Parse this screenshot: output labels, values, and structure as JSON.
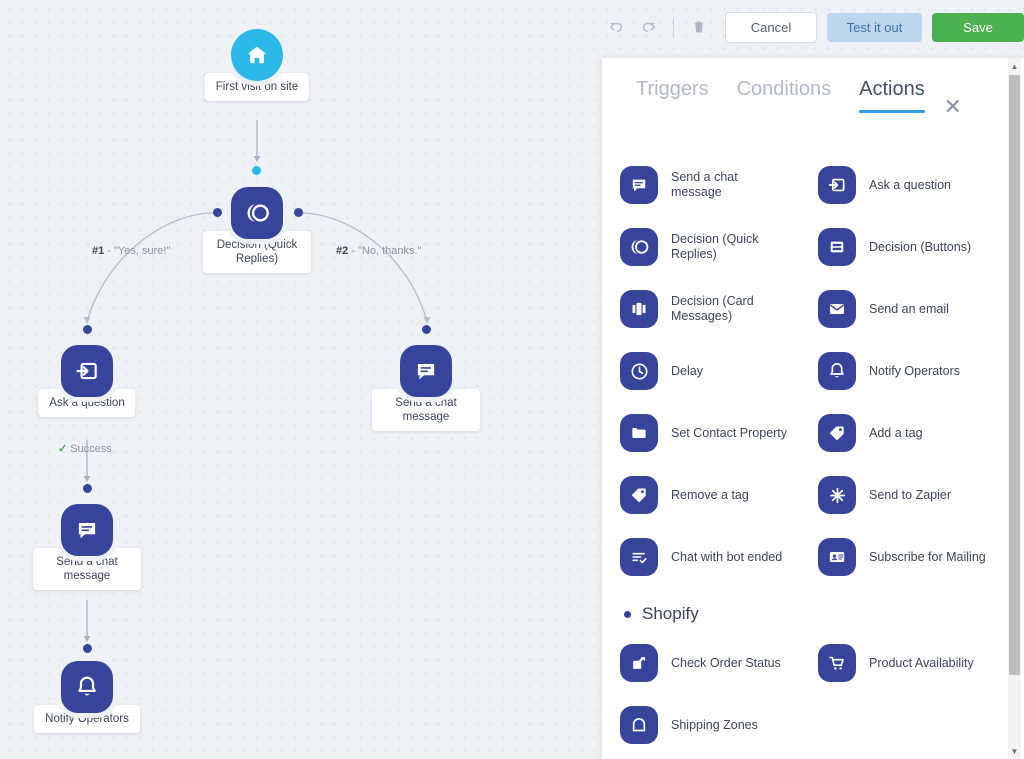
{
  "toolbar": {
    "undo_icon": "undo-icon",
    "redo_icon": "redo-icon",
    "delete_icon": "trash-icon",
    "cancel_label": "Cancel",
    "test_label": "Test it out",
    "save_label": "Save"
  },
  "panel": {
    "tabs": [
      {
        "label": "Triggers",
        "active": false
      },
      {
        "label": "Conditions",
        "active": false
      },
      {
        "label": "Actions",
        "active": true
      }
    ],
    "close_icon": "close-icon",
    "actions": [
      {
        "label": "Send a chat message",
        "icon": "chat-message-icon"
      },
      {
        "label": "Ask a question",
        "icon": "ask-question-icon"
      },
      {
        "label": "Decision (Quick Replies)",
        "icon": "quick-replies-icon"
      },
      {
        "label": "Decision (Buttons)",
        "icon": "decision-buttons-icon"
      },
      {
        "label": "Decision (Card Messages)",
        "icon": "card-messages-icon"
      },
      {
        "label": "Send an email",
        "icon": "email-icon"
      },
      {
        "label": "Delay",
        "icon": "clock-icon"
      },
      {
        "label": "Notify Operators",
        "icon": "bell-icon"
      },
      {
        "label": "Set Contact Property",
        "icon": "folder-icon"
      },
      {
        "label": "Add a tag",
        "icon": "tag-icon"
      },
      {
        "label": "Remove a tag",
        "icon": "tag-icon"
      },
      {
        "label": "Send to Zapier",
        "icon": "zapier-icon"
      },
      {
        "label": "Chat with bot ended",
        "icon": "chat-ended-icon"
      },
      {
        "label": "Subscribe for Mailing",
        "icon": "contact-card-icon"
      }
    ],
    "shopify": {
      "title": "Shopify",
      "items": [
        {
          "label": "Check Order Status",
          "icon": "order-status-icon"
        },
        {
          "label": "Product Availability",
          "icon": "cart-icon"
        },
        {
          "label": "Shipping Zones",
          "icon": "shipping-icon"
        }
      ]
    }
  },
  "flow": {
    "nodes": [
      {
        "id": "trigger",
        "label": "First visit on site",
        "icon": "home-icon",
        "kind": "trigger"
      },
      {
        "id": "decision",
        "label": "Decision (Quick Replies)",
        "icon": "quick-replies-icon",
        "kind": "action"
      },
      {
        "id": "ask",
        "label": "Ask a question",
        "icon": "ask-question-icon",
        "kind": "action"
      },
      {
        "id": "chat-right",
        "label": "Send a chat message",
        "icon": "chat-message-icon",
        "kind": "action"
      },
      {
        "id": "chat-left",
        "label": "Send a chat message",
        "icon": "chat-message-icon",
        "kind": "action"
      },
      {
        "id": "notify",
        "label": "Notify Operators",
        "icon": "bell-icon",
        "kind": "action"
      }
    ],
    "branch_1_num": "#1",
    "branch_1_text": " - \"Yes, sure!\"",
    "branch_2_num": "#2",
    "branch_2_text": " - \"No, thanks.\"",
    "success_label": "Success"
  },
  "colors": {
    "node_blue": "#36459b",
    "trigger_cyan": "#2cb8e8",
    "accent_blue": "#2f9de3",
    "save_green": "#4cb050",
    "test_blue": "#bcd6ee",
    "canvas_bg": "#eef1f5"
  }
}
